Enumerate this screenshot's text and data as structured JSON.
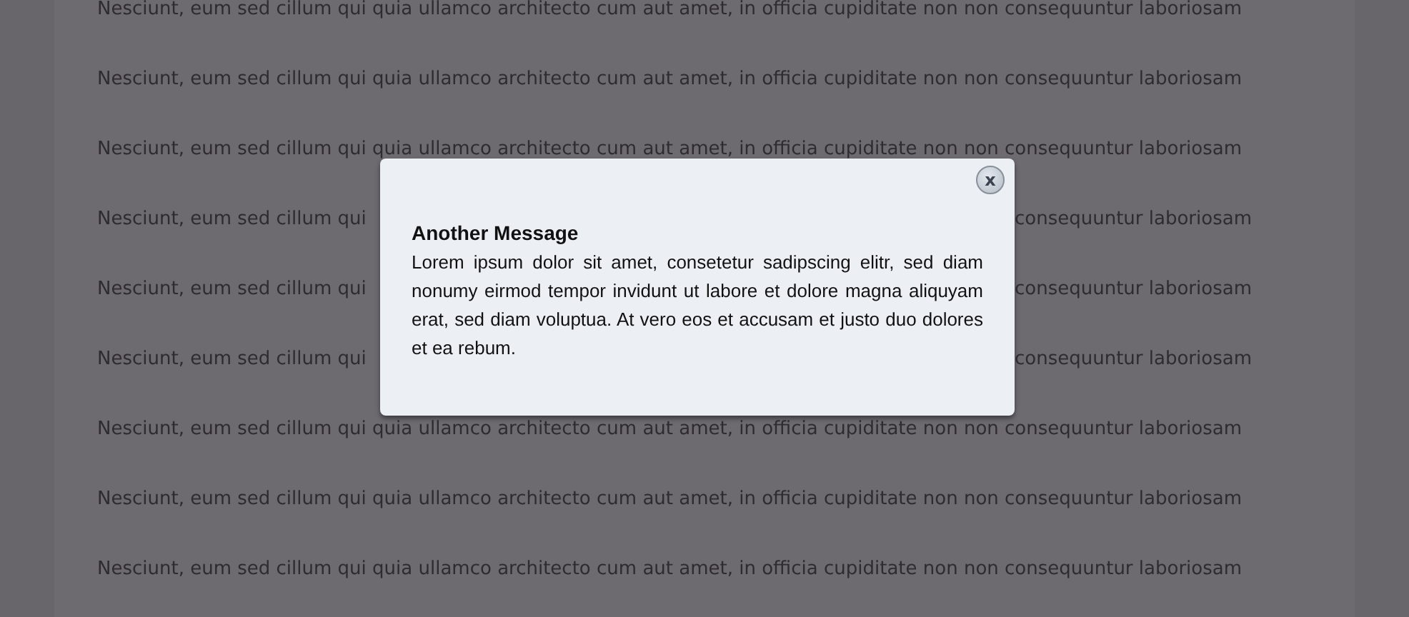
{
  "background_lines": [
    {
      "kind": "full",
      "text": "Nesciunt, eum sed cillum qui quia ullamco architecto cum aut amet, in officia cupiditate non non consequuntur laboriosam"
    },
    {
      "kind": "full",
      "text": "Nesciunt, eum sed cillum qui quia ullamco architecto cum aut amet, in officia cupiditate non non consequuntur laboriosam"
    },
    {
      "kind": "full",
      "text": "Nesciunt, eum sed cillum qui quia ullamco architecto cum aut amet, in officia cupiditate non non consequuntur laboriosam"
    },
    {
      "kind": "split",
      "left": "Nesciunt, eum sed cillum qui",
      "right": "consequuntur laboriosam"
    },
    {
      "kind": "split",
      "left": "Nesciunt, eum sed cillum qui",
      "right": "consequuntur laboriosam"
    },
    {
      "kind": "split",
      "left": "Nesciunt, eum sed cillum qui",
      "right": "consequuntur laboriosam"
    },
    {
      "kind": "full",
      "text": "Nesciunt, eum sed cillum qui quia ullamco architecto cum aut amet, in officia cupiditate non non consequuntur laboriosam"
    },
    {
      "kind": "full",
      "text": "Nesciunt, eum sed cillum qui quia ullamco architecto cum aut amet, in officia cupiditate non non consequuntur laboriosam"
    },
    {
      "kind": "full",
      "text": "Nesciunt, eum sed cillum qui quia ullamco architecto cum aut amet, in officia cupiditate non non consequuntur laboriosam"
    }
  ],
  "dialog": {
    "close": "x",
    "title": "Another Message",
    "body": "Lorem ipsum dolor sit amet, consetetur sadipscing elitr, sed diam nonumy eirmod tempor invidunt ut labore et dolore magna aliquyam erat, sed diam voluptua. At vero eos et accusam et justo duo dolores et ea rebum."
  }
}
